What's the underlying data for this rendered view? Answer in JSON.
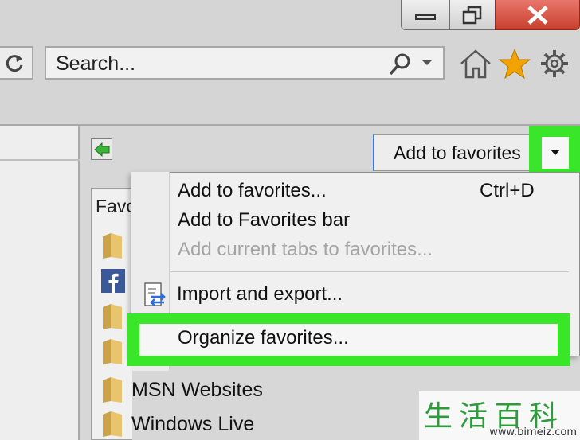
{
  "window": {
    "minimize_icon": "minimize-icon",
    "restore_icon": "restore-icon",
    "close_icon": "close-icon"
  },
  "toolbar": {
    "search_placeholder": "Search...",
    "icons": [
      "refresh-icon",
      "search-icon",
      "chevron-down-icon",
      "home-icon",
      "star-icon",
      "gear-icon"
    ],
    "star_color": "#f2a300"
  },
  "favorites_pane": {
    "back_icon": "green-arrow-icon",
    "add_button_label": "Add to favorites",
    "header": "Favo",
    "folders": [
      "MSN Websites",
      "Windows Live"
    ]
  },
  "menu": {
    "items": [
      {
        "label": "Add to favorites...",
        "shortcut": "Ctrl+D"
      },
      {
        "label": "Add to Favorites bar"
      },
      {
        "label": "Add current tabs to favorites...",
        "disabled": true
      },
      {
        "label": "Import and export..."
      },
      {
        "label": "Organize favorites..."
      }
    ]
  },
  "highlight_color": "#39e629",
  "watermark": {
    "chars": "生活百科",
    "url": "www.bimeiz.com"
  }
}
